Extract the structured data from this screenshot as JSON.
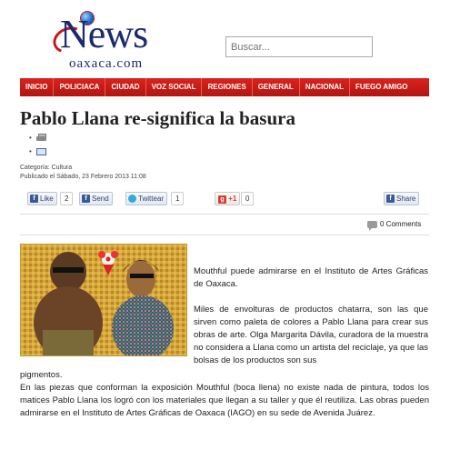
{
  "header": {
    "logo_main": "News",
    "logo_sub": "oaxaca.com",
    "search_placeholder": "Buscar..."
  },
  "nav": {
    "items": [
      "INICIO",
      "POLICIACA",
      "CIUDAD",
      "VOZ SOCIAL",
      "REGIONES",
      "GENERAL",
      "NACIONAL",
      "FUEGO AMIGO"
    ]
  },
  "article": {
    "title": "Pablo Llana re-significa la basura",
    "category": "Categoría: Cultura",
    "published": "Publicado el Sábado, 23 Febrero 2013 11:08",
    "paragraph1": "Mouthful puede admirarse en el Instituto de Artes Gráficas de Oaxaca.",
    "paragraph2": "Miles de envolturas de productos chatarra, son las que sirven como paleta de colores a Pablo Llana para crear sus obras de arte. Olga Margarita Dávila, curadora de la muestra no considera a Llana como un artista del reciclaje, ya que las bolsas de los productos son sus",
    "paragraph3": "pigmentos.",
    "paragraph4": "En las piezas que conforman la exposición Mouthful (boca llena) no existe nada de pintura, todos los matices Pablo Llana los logró con los materiales que llegan a su taller y que él reutiliza. Las obras pueden admirarse en el Instituto de Artes Gráficas de Oaxaca (IAGO) en su sede de Avenida Juárez."
  },
  "social": {
    "like_label": "Like",
    "like_count": "2",
    "send_label": "Send",
    "tweet_label": "Twittear",
    "tweet_count": "1",
    "gplus_label": "+1",
    "gplus_count": "0",
    "share_label": "Share"
  },
  "comments": {
    "label": "0 Comments"
  },
  "icons": {
    "print": "printer-icon",
    "email": "email-icon",
    "facebook": "facebook-icon",
    "twitter": "twitter-icon",
    "gplus": "google-plus-icon",
    "comment": "comment-icon"
  },
  "colors": {
    "nav_red": "#c41a15",
    "logo_blue": "#1b2b6e",
    "logo_red": "#c8181e",
    "fb_blue": "#3b5998"
  }
}
